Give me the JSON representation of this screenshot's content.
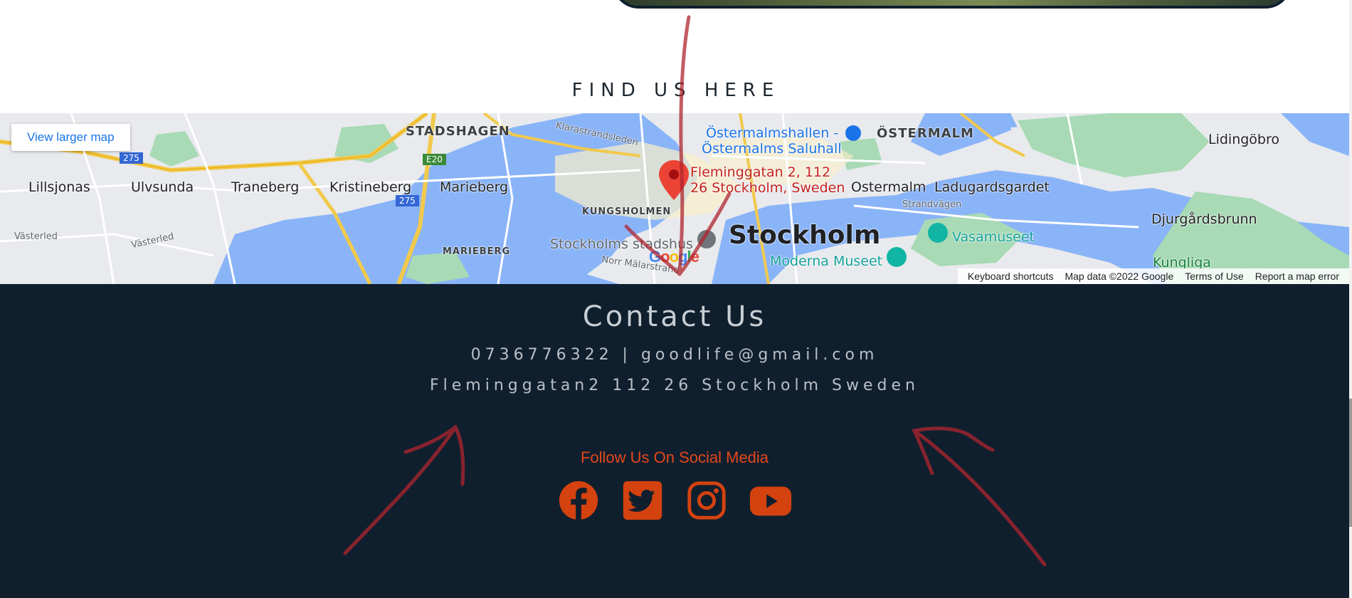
{
  "find_us": {
    "title": "FIND US HERE"
  },
  "map": {
    "view_larger_label": "View larger map",
    "pin_label_line1": "Fleminggatan 2, 112",
    "pin_label_line2": "26 Stockholm, Sweden",
    "labels": {
      "stadshagen": "STADSHAGEN",
      "klarastrandsleden": "Klarastrandsleden",
      "ostermalmshallen1": "Östermalmshallen -",
      "ostermalmshallen2": "Östermalms Saluhall",
      "ostermalm_caps": "ÖSTERMALM",
      "lidingobro": "Lidingöbro",
      "lillsjonas": "Lillsjonas",
      "ulvsunda": "Ulvsunda",
      "traneberg": "Traneberg",
      "kristineberg": "Kristineberg",
      "marieberg": "Marieberg",
      "ostermalm": "Ostermalm",
      "ladugardsgardet": "Ladugardsgardet",
      "kungsholmen": "KUNGSHOLMEN",
      "strandvagen": "Strandvägen",
      "djurgardsbrunn": "Djurgårdsbrunn",
      "vasterled1": "Västerled",
      "vasterled2": "Västerled",
      "marieberg_caps": "MARIEBERG",
      "stadshus": "Stockholms stadshus",
      "stockholm": "Stockholm",
      "vasamuseet": "Vasamuseet",
      "moderna": "Moderna Museet",
      "norr_malarstrand": "Norr Mälarstrand",
      "kungliga": "Kungliga",
      "road_275a": "275",
      "road_275b": "275",
      "road_e20": "E20"
    },
    "logo": "Google",
    "attribution": {
      "keyboard": "Keyboard shortcuts",
      "map_data": "Map data ©2022 Google",
      "terms": "Terms of Use",
      "report": "Report a map error"
    }
  },
  "footer": {
    "contact_title": "Contact Us",
    "contact_line": "0736776322 | goodlife@gmail.com",
    "address_line": "Fleminggatan2 112 26 Stockholm Sweden",
    "social_title": "Follow Us On Social Media",
    "social_icons": [
      "facebook-icon",
      "twitter-icon",
      "instagram-icon",
      "youtube-icon"
    ],
    "social_color": "#d4420f"
  },
  "colors": {
    "footer_bg": "#101f2e",
    "water": "#8ab4f8",
    "park": "#a8dab5",
    "annotation": "#b0252f"
  }
}
